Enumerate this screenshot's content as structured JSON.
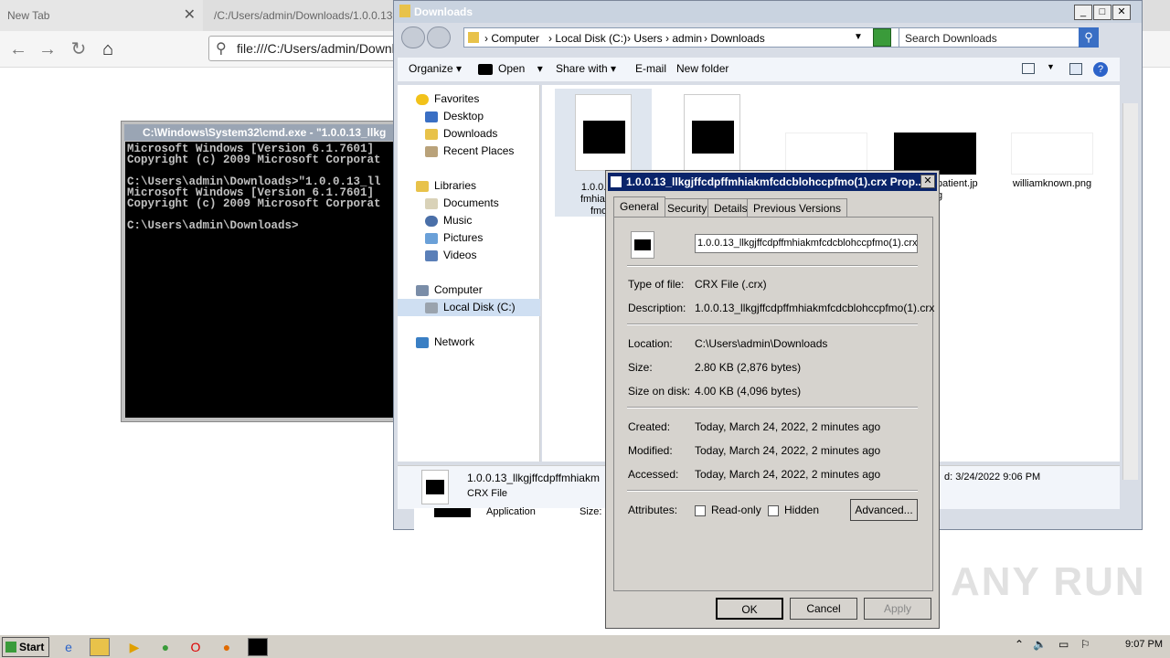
{
  "browser": {
    "tabs": [
      {
        "label": "New Tab"
      },
      {
        "label": "/C:/Users/admin/Downloads/1.0.0.13"
      }
    ],
    "url": "file:///C:/Users/admin/Downlo"
  },
  "cmd": {
    "title": "C:\\Windows\\System32\\cmd.exe - \"1.0.0.13_llkg",
    "lines": "Microsoft Windows [Version 6.1.7601]\nCopyright (c) 2009 Microsoft Corporat\n\nC:\\Users\\admin\\Downloads>\"1.0.0.13_ll\nMicrosoft Windows [Version 6.1.7601]\nCopyright (c) 2009 Microsoft Corporat\n\nC:\\Users\\admin\\Downloads>"
  },
  "explorer": {
    "title": "Downloads",
    "breadcrumbs": [
      "Computer",
      "Local Disk (C:)",
      "Users",
      "admin",
      "Downloads"
    ],
    "search_placeholder": "Search Downloads",
    "commands": {
      "organize": "Organize",
      "open": "Open",
      "share": "Share with",
      "email": "E-mail",
      "new_folder": "New folder"
    },
    "nav": {
      "favorites": "Favorites",
      "desktop": "Desktop",
      "downloads": "Downloads",
      "recent": "Recent Places",
      "libraries": "Libraries",
      "documents": "Documents",
      "music": "Music",
      "pictures": "Pictures",
      "videos": "Videos",
      "computer": "Computer",
      "local_disk": "Local Disk (C:)",
      "network": "Network"
    },
    "files": {
      "f1": "1.0.0.13_l\nfmhiakmfc\nfmo(1",
      "f4": "patient.jp\ng",
      "f5": "williamknown.png"
    },
    "details": {
      "name": "1.0.0.13_llkgjffcdpffmhiakm",
      "type": "CRX File",
      "date": "d: 3/24/2022 9:06 PM",
      "behind_type": "Application",
      "behind_size": "Size:"
    }
  },
  "dialog": {
    "title": "1.0.0.13_llkgjffcdpffmhiakmfcdcblohccpfmo(1).crx Prop...",
    "tabs": [
      "General",
      "Security",
      "Details",
      "Previous Versions"
    ],
    "filename": "1.0.0.13_llkgjffcdpffmhiakmfcdcblohccpfmo(1).crx",
    "type_label": "Type of file:",
    "type_value": "CRX File (.crx)",
    "desc_label": "Description:",
    "desc_value": "1.0.0.13_llkgjffcdpffmhiakmfcdcblohccpfmo(1).crx",
    "loc_label": "Location:",
    "loc_value": "C:\\Users\\admin\\Downloads",
    "size_label": "Size:",
    "size_value": "2.80 KB (2,876 bytes)",
    "disk_label": "Size on disk:",
    "disk_value": "4.00 KB (4,096 bytes)",
    "created_label": "Created:",
    "created_value": "Today, March 24, 2022, 2 minutes ago",
    "modified_label": "Modified:",
    "modified_value": "Today, March 24, 2022, 2 minutes ago",
    "accessed_label": "Accessed:",
    "accessed_value": "Today, March 24, 2022, 2 minutes ago",
    "attr_label": "Attributes:",
    "readonly": "Read-only",
    "hidden": "Hidden",
    "advanced": "Advanced...",
    "ok": "OK",
    "cancel": "Cancel",
    "apply": "Apply"
  },
  "taskbar": {
    "start": "Start",
    "clock": "9:07 PM"
  },
  "watermark": "ANY RUN"
}
